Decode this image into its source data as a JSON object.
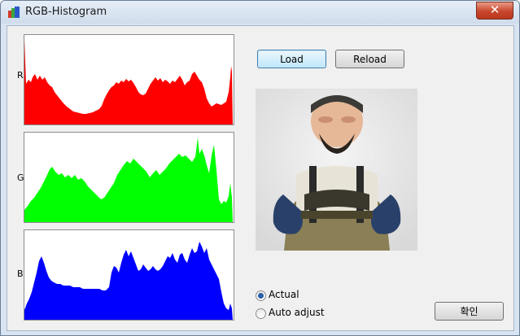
{
  "window": {
    "title": "RGB-Histogram",
    "close_glyph": "✕"
  },
  "histograms": [
    {
      "label": "R",
      "color": "#ff0000"
    },
    {
      "label": "G",
      "color": "#00ff00"
    },
    {
      "label": "B",
      "color": "#0000ff"
    }
  ],
  "buttons": {
    "load": "Load",
    "reload": "Reload",
    "ok": "확인"
  },
  "options": {
    "actual": "Actual",
    "auto_adjust": "Auto adjust",
    "selected": "actual"
  },
  "image": {
    "description_icon": "bearded-figure-photo"
  }
}
